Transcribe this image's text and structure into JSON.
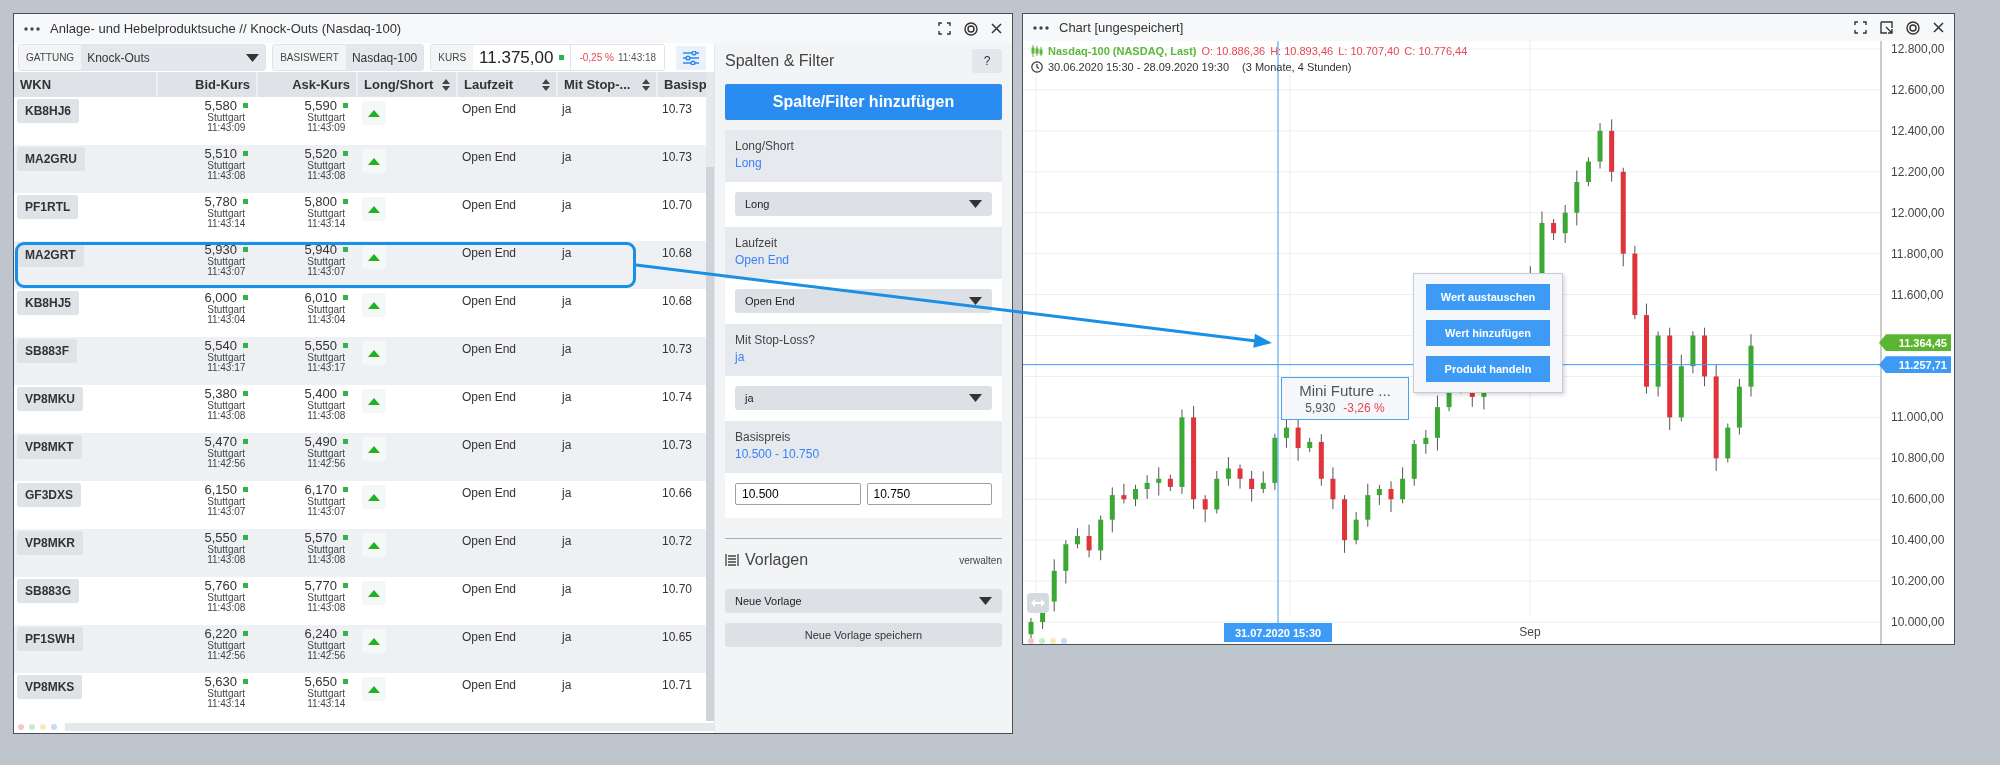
{
  "search_window": {
    "title": "Anlage- und Hebelproduktsuche // Knock-Outs (Nasdaq-100)",
    "toolbar": {
      "type_label": "GATTUNG",
      "type_value": "Knock-Outs",
      "underlying_label": "BASISWERT",
      "underlying_value": "Nasdaq-100",
      "price_label": "KURS",
      "price_value": "11.375,00",
      "change": "-0,25 %",
      "time": "11:43:18"
    },
    "table": {
      "columns": [
        {
          "label": "WKN",
          "sortable": false
        },
        {
          "label": "Bid-Kurs",
          "sortable": false
        },
        {
          "label": "Ask-Kurs",
          "sortable": false
        },
        {
          "label": "Long/Short",
          "sortable": true
        },
        {
          "label": "Laufzeit",
          "sortable": true
        },
        {
          "label": "Mit Stop-...",
          "sortable": true
        },
        {
          "label": "Basisp"
        }
      ],
      "rows": [
        {
          "wkn": "KB8HJ6",
          "bid": "5,580",
          "bid_venue": "Stuttgart",
          "bid_time": "11:43:09",
          "ask": "5,590",
          "ask_venue": "Stuttgart",
          "ask_time": "11:43:09",
          "term": "Open End",
          "stop_loss": "ja",
          "strike": "10.73",
          "selected": false
        },
        {
          "wkn": "MA2GRU",
          "bid": "5,510",
          "bid_venue": "Stuttgart",
          "bid_time": "11:43:08",
          "ask": "5,520",
          "ask_venue": "Stuttgart",
          "ask_time": "11:43:08",
          "term": "Open End",
          "stop_loss": "ja",
          "strike": "10.73",
          "selected": false
        },
        {
          "wkn": "PF1RTL",
          "bid": "5,780",
          "bid_venue": "Stuttgart",
          "bid_time": "11:43:14",
          "ask": "5,800",
          "ask_venue": "Stuttgart",
          "ask_time": "11:43:14",
          "term": "Open End",
          "stop_loss": "ja",
          "strike": "10.70",
          "selected": false
        },
        {
          "wkn": "MA2GRT",
          "bid": "5,930",
          "bid_venue": "Stuttgart",
          "bid_time": "11:43:07",
          "ask": "5,940",
          "ask_venue": "Stuttgart",
          "ask_time": "11:43:07",
          "term": "Open End",
          "stop_loss": "ja",
          "strike": "10.68",
          "selected": true
        },
        {
          "wkn": "KB8HJ5",
          "bid": "6,000",
          "bid_venue": "Stuttgart",
          "bid_time": "11:43:04",
          "ask": "6,010",
          "ask_venue": "Stuttgart",
          "ask_time": "11:43:04",
          "term": "Open End",
          "stop_loss": "ja",
          "strike": "10.68",
          "selected": false
        },
        {
          "wkn": "SB883F",
          "bid": "5,540",
          "bid_venue": "Stuttgart",
          "bid_time": "11:43:17",
          "ask": "5,550",
          "ask_venue": "Stuttgart",
          "ask_time": "11:43:17",
          "term": "Open End",
          "stop_loss": "ja",
          "strike": "10.73",
          "selected": false
        },
        {
          "wkn": "VP8MKU",
          "bid": "5,380",
          "bid_venue": "Stuttgart",
          "bid_time": "11:43:08",
          "ask": "5,400",
          "ask_venue": "Stuttgart",
          "ask_time": "11:43:08",
          "term": "Open End",
          "stop_loss": "ja",
          "strike": "10.74",
          "selected": false
        },
        {
          "wkn": "VP8MKT",
          "bid": "5,470",
          "bid_venue": "Stuttgart",
          "bid_time": "11:42:56",
          "ask": "5,490",
          "ask_venue": "Stuttgart",
          "ask_time": "11:42:56",
          "term": "Open End",
          "stop_loss": "ja",
          "strike": "10.73",
          "selected": false
        },
        {
          "wkn": "GF3DXS",
          "bid": "6,150",
          "bid_venue": "Stuttgart",
          "bid_time": "11:43:07",
          "ask": "6,170",
          "ask_venue": "Stuttgart",
          "ask_time": "11:43:07",
          "term": "Open End",
          "stop_loss": "ja",
          "strike": "10.66",
          "selected": false
        },
        {
          "wkn": "VP8MKR",
          "bid": "5,550",
          "bid_venue": "Stuttgart",
          "bid_time": "11:43:08",
          "ask": "5,570",
          "ask_venue": "Stuttgart",
          "ask_time": "11:43:08",
          "term": "Open End",
          "stop_loss": "ja",
          "strike": "10.72",
          "selected": false
        },
        {
          "wkn": "SB883G",
          "bid": "5,760",
          "bid_venue": "Stuttgart",
          "bid_time": "11:43:08",
          "ask": "5,770",
          "ask_venue": "Stuttgart",
          "ask_time": "11:43:08",
          "term": "Open End",
          "stop_loss": "ja",
          "strike": "10.70",
          "selected": false
        },
        {
          "wkn": "PF1SWH",
          "bid": "6,220",
          "bid_venue": "Stuttgart",
          "bid_time": "11:42:56",
          "ask": "6,240",
          "ask_venue": "Stuttgart",
          "ask_time": "11:42:56",
          "term": "Open End",
          "stop_loss": "ja",
          "strike": "10.65",
          "selected": false
        },
        {
          "wkn": "VP8MKS",
          "bid": "5,630",
          "bid_venue": "Stuttgart",
          "bid_time": "11:43:14",
          "ask": "5,650",
          "ask_venue": "Stuttgart",
          "ask_time": "11:43:14",
          "term": "Open End",
          "stop_loss": "ja",
          "strike": "10.71",
          "selected": false
        }
      ]
    },
    "filter_panel": {
      "title": "Spalten & Filter",
      "help": "?",
      "add_button": "Spalte/Filter hinzufügen",
      "filters": [
        {
          "kind": "select",
          "label": "Long/Short",
          "summary": "Long",
          "value": "Long"
        },
        {
          "kind": "select",
          "label": "Laufzeit",
          "summary": "Open End",
          "value": "Open End"
        },
        {
          "kind": "select",
          "label": "Mit Stop-Loss?",
          "summary": "ja",
          "value": "ja"
        },
        {
          "kind": "range",
          "label": "Basispreis",
          "summary": "10.500 - 10.750",
          "from": "10.500",
          "to": "10.750"
        }
      ],
      "templates": {
        "title": "Vorlagen",
        "manage": "verwalten",
        "select": "Neue Vorlage",
        "save": "Neue Vorlage speichern"
      }
    }
  },
  "chart_window": {
    "title": "Chart [ungespeichert]",
    "legend": {
      "instrument": "Nasdaq-100 (NASDAQ, Last)",
      "ohlc": [
        "O: 10.886,36",
        "H: 10.893,46",
        "L: 10.707,40",
        "C: 10.776,44"
      ],
      "period": "30.06.2020 15:30 - 28.09.2020 19:30",
      "duration": "(3 Monate, 4 Stunden)"
    },
    "y_axis_labels": [
      "12.800,00",
      "12.600,00",
      "12.400,00",
      "12.200,00",
      "12.000,00",
      "11.800,00",
      "11.600,00",
      "11.000,00",
      "10.800,00",
      "10.600,00",
      "10.400,00",
      "10.200,00",
      "10.000,00"
    ],
    "x_axis_labels": [
      "Sep"
    ],
    "price_tags": [
      {
        "label": "11.364,45",
        "color": "#5cb532"
      },
      {
        "label": "11.257,71",
        "color": "#3d9bf5"
      }
    ],
    "crosshair_label": "31.07.2020 15:30",
    "context_menu": [
      "Wert austauschen",
      "Wert hinzufügen",
      "Produkt handeln"
    ],
    "tooltip": {
      "title": "Mini Future ...",
      "price": "5,930",
      "change": "-3,26 %"
    }
  }
}
